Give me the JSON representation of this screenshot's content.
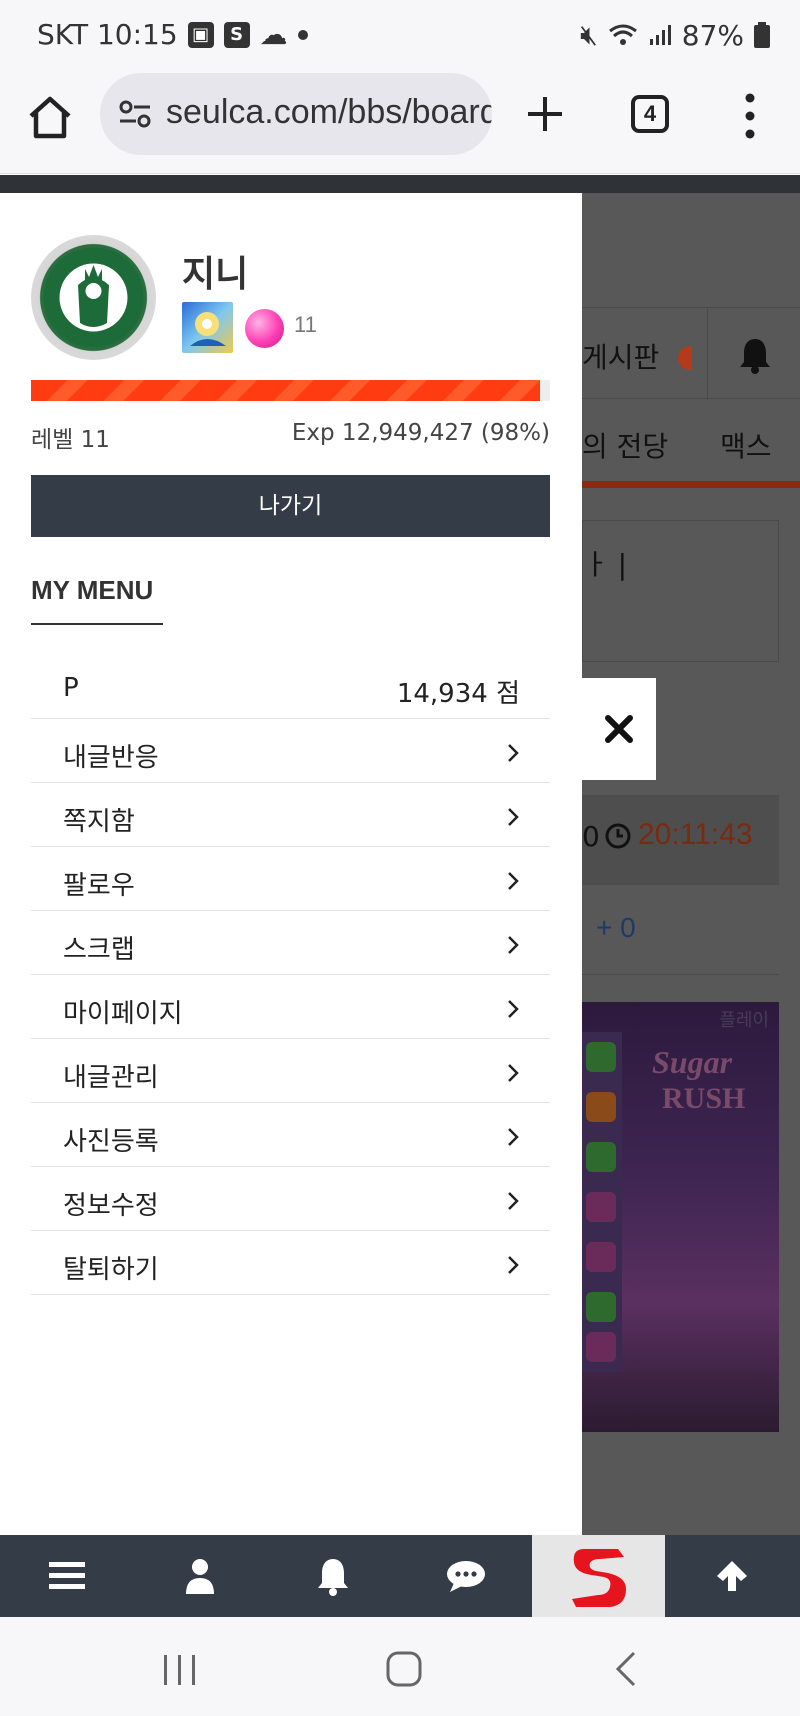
{
  "status_bar": {
    "carrier_time": "SKT 10:15",
    "battery": "87%"
  },
  "browser": {
    "url": "seulca.com/bbs/board",
    "tab_count": "4"
  },
  "background_page": {
    "nav_label": "게시판",
    "tabs": [
      "의 전당",
      "맥스"
    ],
    "box_text": "ㅏ |",
    "timer_prefix": "0",
    "timer": "20:11:43",
    "plus_count": "+ 0",
    "banner_corner": "플레이",
    "banner_logo_1": "Sugar",
    "banner_logo_2": "RUSH"
  },
  "profile": {
    "name": "지니",
    "level_number": "11",
    "level_label": "레벨 11",
    "exp_label": "Exp 12,949,427 (98%)",
    "progress": 0.98,
    "exit_label": "나가기"
  },
  "menu": {
    "title": "MY MENU",
    "points_label": "P",
    "points_value": "14,934 점",
    "items": [
      {
        "label": "내글반응"
      },
      {
        "label": "쪽지함"
      },
      {
        "label": "팔로우"
      },
      {
        "label": "스크랩"
      },
      {
        "label": "마이페이지"
      },
      {
        "label": "내글관리"
      },
      {
        "label": "사진등록"
      },
      {
        "label": "정보수정"
      },
      {
        "label": "탈퇴하기"
      }
    ]
  },
  "bottom_bar": {
    "items": [
      "menu-icon",
      "user-icon",
      "bell-icon",
      "chat-icon",
      "site-logo",
      "arrow-up-icon"
    ]
  },
  "colors": {
    "panel_dark": "#343c47",
    "xp_orange": "#ff3b12",
    "overlay": "#585858"
  }
}
